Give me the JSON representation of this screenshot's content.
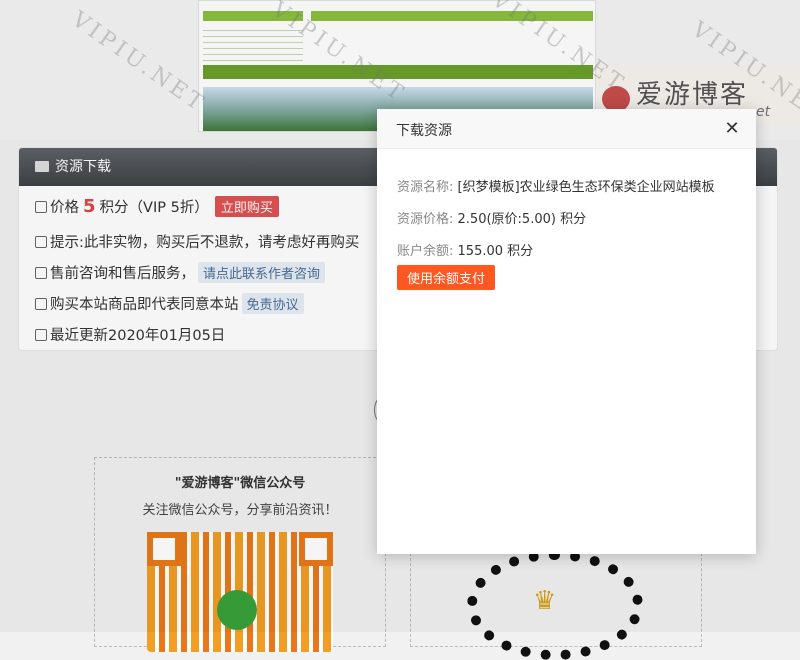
{
  "hero": {
    "logo_text": "爱游博客",
    "logo_sub": "et",
    "watermark": "VIPIU.NET"
  },
  "panel": {
    "title": "资源下载",
    "price_label": "价格",
    "price_value": "5",
    "price_unit": "积分（VIP 5折）",
    "buy_label": "立即购买",
    "notice": "提示:此非实物，购买后不退款，请考虑好再购买",
    "consult_text": "售前咨询和售后服务，",
    "consult_link": "请点此联系作者咨询",
    "agree_text": "购买本站商品即代表同意本站",
    "agree_link": "免责协议",
    "updated": "最近更新2020年01月05日"
  },
  "qr": {
    "title": "\"爱游博客\"微信公众号",
    "subtitle": "关注微信公众号，分享前沿资讯！"
  },
  "modal": {
    "title": "下载资源",
    "close_glyph": "✕",
    "name_label": "资源名称:",
    "name_value": "[织梦模板]农业绿色生态环保类企业网站模板",
    "price_label": "资源价格:",
    "price_value": "2.50(原价:5.00) 积分",
    "balance_label": "账户余额:",
    "balance_value": "155.00 积分",
    "pay_label": "使用余额支付"
  },
  "colors": {
    "buy": "#e05252",
    "pay": "#ff5722",
    "price": "#e24444",
    "header": "#4a4e52"
  }
}
